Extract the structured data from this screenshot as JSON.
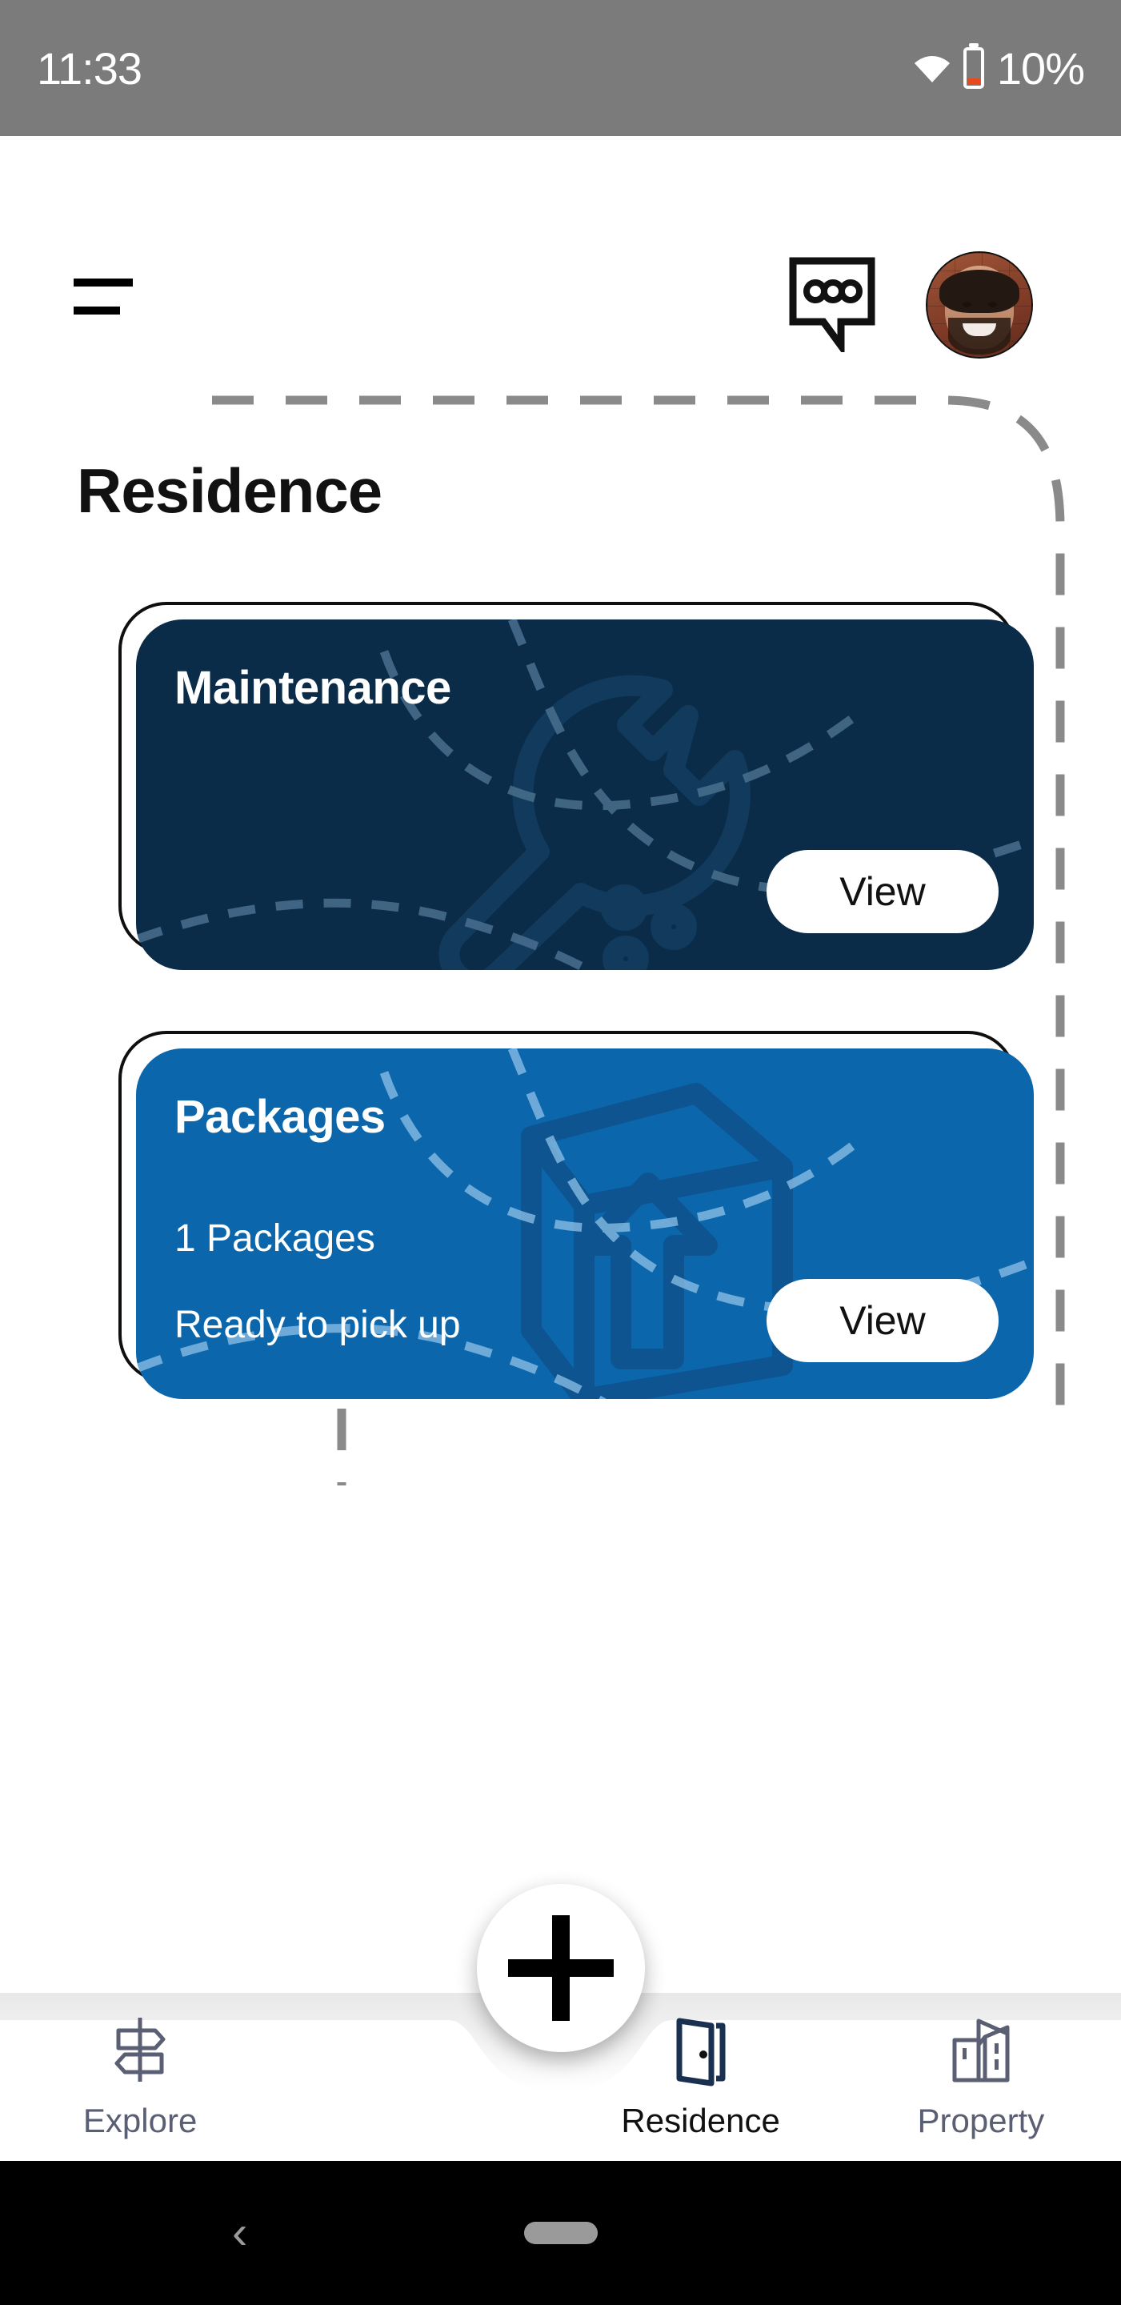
{
  "status_bar": {
    "time": "11:33",
    "battery_percent": "10%",
    "wifi_icon": "wifi-icon",
    "battery_icon": "battery-low-icon",
    "background_color": "#7b7b7b"
  },
  "header": {
    "menu_icon": "hamburger-menu-icon",
    "chat_icon": "chat-bubble-icon",
    "avatar_alt": "user-avatar"
  },
  "page": {
    "title": "Residence"
  },
  "cards": [
    {
      "name": "maintenance",
      "title": "Maintenance",
      "line1": "",
      "line2": "",
      "button_label": "View",
      "color": "#0a2c49",
      "watermark_icon": "wrench-icon"
    },
    {
      "name": "packages",
      "title": "Packages",
      "line1": "1 Packages",
      "line2": "Ready to pick up",
      "button_label": "View",
      "color": "#0b66ab",
      "watermark_icon": "package-box-icon"
    }
  ],
  "fab": {
    "icon": "plus-icon",
    "label": "+"
  },
  "bottom_nav": {
    "items": [
      {
        "label": "Explore",
        "icon": "signpost-icon",
        "active": false
      },
      {
        "label": "Residence",
        "icon": "open-door-icon",
        "active": true
      },
      {
        "label": "Property",
        "icon": "buildings-icon",
        "active": false
      }
    ]
  },
  "android_nav": {
    "back_icon": "back-chevron-icon",
    "back_glyph": "‹",
    "home_icon": "home-indicator-pill"
  },
  "colors": {
    "maintenance_card": "#0a2c49",
    "packages_card": "#0b66ab",
    "dashed_path": "#8a8a8a",
    "nav_inactive": "#5a5f73",
    "nav_active": "#111111",
    "status_bar": "#7b7b7b",
    "battery_low": "#e8491d"
  }
}
